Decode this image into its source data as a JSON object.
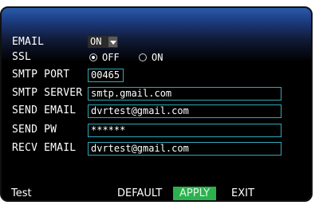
{
  "form": {
    "email": {
      "label": "EMAIL",
      "value": "ON",
      "icon": "chevron-down-icon"
    },
    "ssl": {
      "label": "SSL",
      "options": [
        {
          "label": "OFF",
          "selected": true
        },
        {
          "label": "ON",
          "selected": false
        }
      ]
    },
    "smtp_port": {
      "label": "SMTP PORT",
      "value": "00465"
    },
    "smtp_server": {
      "label": "SMTP SERVER",
      "value": "smtp.gmail.com"
    },
    "send_email": {
      "label": "SEND EMAIL",
      "value": "dvrtest@gmail.com"
    },
    "send_pw": {
      "label": "SEND PW",
      "value": "******"
    },
    "recv_email": {
      "label": "RECV EMAIL",
      "value": "dvrtest@gmail.com"
    }
  },
  "footer": {
    "test": "Test",
    "default": "DEFAULT",
    "apply": "APPLY",
    "exit": "EXIT"
  },
  "colors": {
    "field_border": "#2fa9b8",
    "apply_bg": "#2bb14e",
    "header_blue": "#2b5ba8",
    "background": "#000000"
  }
}
